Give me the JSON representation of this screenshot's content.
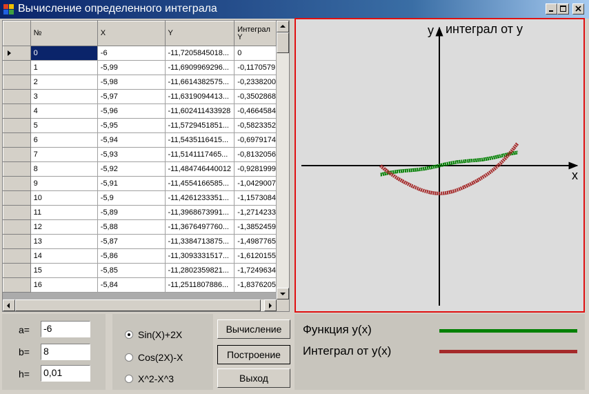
{
  "window": {
    "title": "Вычисление определенного интеграла"
  },
  "grid": {
    "columns": [
      "№",
      "X",
      "Y",
      "Интеграл Y"
    ],
    "rows": [
      [
        "0",
        "-6",
        "-11,7205845018...",
        "0"
      ],
      [
        "1",
        "-5,99",
        "-11,6909969296...",
        "-0,1170579"
      ],
      [
        "2",
        "-5,98",
        "-11,6614382575...",
        "-0,2338200"
      ],
      [
        "3",
        "-5,97",
        "-11,6319094413...",
        "-0,3502868"
      ],
      [
        "4",
        "-5,96",
        "-11,602411433928",
        "-0,4664584"
      ],
      [
        "5",
        "-5,95",
        "-11,5729451851...",
        "-0,5823352"
      ],
      [
        "6",
        "-5,94",
        "-11,5435116415...",
        "-0,6979174"
      ],
      [
        "7",
        "-5,93",
        "-11,5141117465...",
        "-0,8132056"
      ],
      [
        "8",
        "-5,92",
        "-11,484746440012",
        "-0,9281999"
      ],
      [
        "9",
        "-5,91",
        "-11,4554166585...",
        "-1,0429007"
      ],
      [
        "10",
        "-5,9",
        "-11,4261233351...",
        "-1,1573084"
      ],
      [
        "11",
        "-5,89",
        "-11,3968673991...",
        "-1,2714233"
      ],
      [
        "12",
        "-5,88",
        "-11,3676497760...",
        "-1,3852459"
      ],
      [
        "13",
        "-5,87",
        "-11,3384713875...",
        "-1,4987765"
      ],
      [
        "14",
        "-5,86",
        "-11,3093331517...",
        "-1,6120155"
      ],
      [
        "15",
        "-5,85",
        "-11,2802359821...",
        "-1,7249634"
      ],
      [
        "16",
        "-5,84",
        "-11,2511807886...",
        "-1,8376205"
      ]
    ]
  },
  "params": {
    "a_label": "a=",
    "a_value": "-6",
    "b_label": "b=",
    "b_value": "8",
    "h_label": "h=",
    "h_value": "0,01"
  },
  "functions": {
    "options": [
      "Sin(X)+2X",
      "Cos(2X)-X",
      "X^2-X^3"
    ],
    "selected_index": 0
  },
  "buttons": {
    "calculate": "Вычисление",
    "plot": "Построение",
    "exit": "Выход"
  },
  "chart": {
    "y_axis_label": "y",
    "y_axis_title": "интеграл от y",
    "x_axis_label": "x",
    "colors": {
      "function": "#008000",
      "integral": "#a52a2a",
      "frame": "#e01010"
    }
  },
  "legend": {
    "function_label": "Функция y(x)",
    "integral_label": "Интеграл от y(x)"
  },
  "chart_data": {
    "type": "line",
    "series": [
      {
        "name": "Функция y(x)",
        "expr": "sin(x)+2x"
      },
      {
        "name": "Интеграл от y(x)",
        "expr": "x^2 - cos(x) + cos(-6) - 36"
      }
    ],
    "x_range": [
      -6,
      8
    ],
    "grid": false
  }
}
